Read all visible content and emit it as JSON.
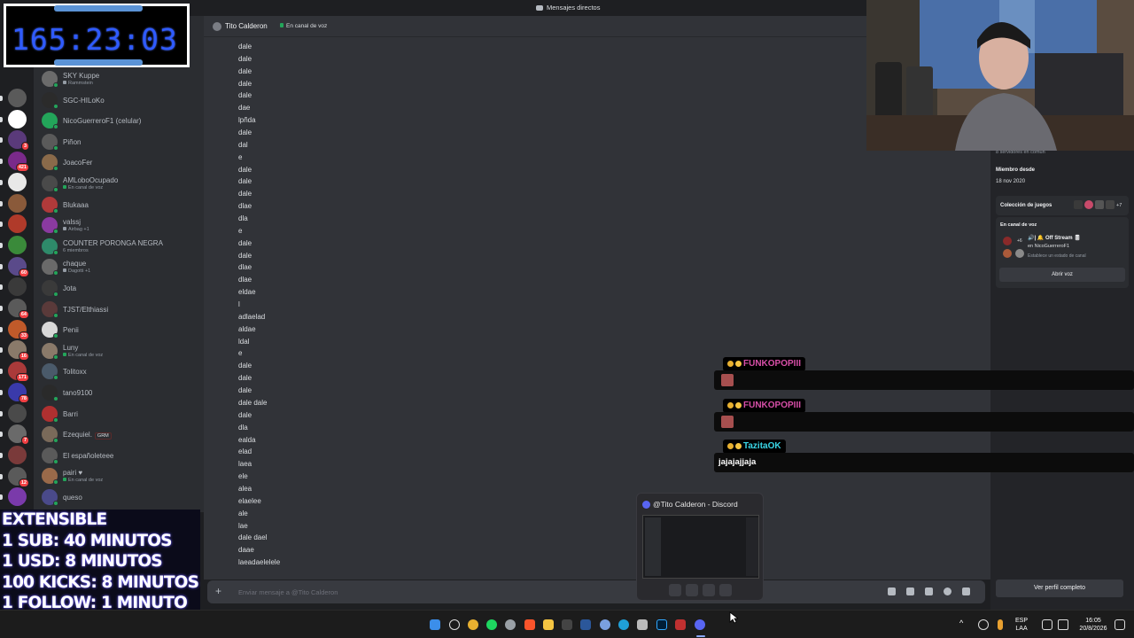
{
  "window": {
    "title": "Mensajes directos"
  },
  "timer": {
    "display": "165:23:03"
  },
  "dm_list": [
    {
      "name": "SKY Kuppe",
      "sub": "Rammstein",
      "icon": "music-icon",
      "color": "#6b6b6b"
    },
    {
      "name": "SGC-HILoKo",
      "sub": "",
      "color": "#2b2b2b"
    },
    {
      "name": "NicoGuerreroF1 (celular)",
      "sub": "",
      "color": "#23a55a"
    },
    {
      "name": "Piñon",
      "sub": "",
      "color": "#5a5a5a"
    },
    {
      "name": "JoacoFer",
      "sub": "",
      "color": "#8a6a4a"
    },
    {
      "name": "AMLoboOcupado",
      "sub": "En canal de voz",
      "icon": "voice-icon",
      "color": "#4a4a4a"
    },
    {
      "name": "Blukaaa",
      "sub": "",
      "color": "#b03a3a"
    },
    {
      "name": "valssj",
      "sub": "Airbag +1",
      "icon": "music-icon",
      "color": "#8a3aa0"
    },
    {
      "name": "COUNTER PORONGA NEGRA",
      "sub": "6 miembros",
      "color": "#2e8a6a"
    },
    {
      "name": "chaque",
      "sub": "Dagotti +1",
      "icon": "music-icon",
      "color": "#6a6a6a"
    },
    {
      "name": "Jota",
      "sub": "",
      "color": "#3a3a3a"
    },
    {
      "name": "TJST/Elthiassi",
      "sub": "",
      "color": "#5a3a3a"
    },
    {
      "name": "Penii",
      "sub": "",
      "color": "#d8d8d8"
    },
    {
      "name": "Luny",
      "sub": "En canal de voz",
      "icon": "voice-icon",
      "color": "#8a7a6a"
    },
    {
      "name": "Tolitoxx",
      "sub": "",
      "color": "#4a5a6a"
    },
    {
      "name": "tano9100",
      "sub": "",
      "color": "#2a2a2a"
    },
    {
      "name": "Barri",
      "sub": "",
      "color": "#b03030"
    },
    {
      "name": "Ezequiel.",
      "sub": "",
      "tag": "GRM",
      "color": "#7a6a5a"
    },
    {
      "name": "El españoleteee",
      "sub": "",
      "color": "#5a5a5a"
    },
    {
      "name": "pairi ♥",
      "sub": "En canal de voz",
      "icon": "voice-icon",
      "color": "#9a6a4a"
    },
    {
      "name": "queso",
      "sub": "",
      "color": "#4a4a8a"
    }
  ],
  "servers": [
    {
      "color": "#5a5a5a"
    },
    {
      "color": "#ffffff"
    },
    {
      "color": "#5a3a7a",
      "badge": "3"
    },
    {
      "color": "#7a2a8a",
      "badge": "421"
    },
    {
      "color": "#e8e8e8"
    },
    {
      "color": "#8a5a3a"
    },
    {
      "color": "#b03a2a"
    },
    {
      "color": "#3a8a3a"
    },
    {
      "color": "#5a4a8a",
      "badge": "60"
    },
    {
      "color": "#3a3a3a"
    },
    {
      "color": "#5a5a5a",
      "badge": "64"
    },
    {
      "color": "#c05a2a",
      "badge": "33"
    },
    {
      "color": "#8a7a6a",
      "badge": "16"
    },
    {
      "color": "#aa3a3a",
      "badge": "171"
    },
    {
      "color": "#3a3aaa",
      "badge": "78"
    },
    {
      "color": "#4a4a4a"
    },
    {
      "color": "#6a6a6a",
      "badge": "7"
    },
    {
      "color": "#7a3a3a"
    },
    {
      "color": "#5a5a5a",
      "badge": "12"
    },
    {
      "color": "#7a3aaa"
    }
  ],
  "chat": {
    "recipient": "Tito Calderon",
    "recipient_status": "En canal de voz",
    "messages": [
      "dale",
      "dale",
      "dale",
      "dale",
      "dale",
      "dae",
      "lpñda",
      "dale",
      "dal",
      "e",
      "dale",
      "dale",
      "dale",
      "dlae",
      "dla",
      "e",
      "dale",
      "dale",
      "dlae",
      "dlae",
      "eldae",
      "l",
      "adlaelad",
      "aldae",
      "ldal",
      "e",
      "dale",
      "dale",
      "dale",
      "dale dale",
      "dale",
      "dla",
      "ealda",
      "elad",
      "laea",
      "ele",
      "alea",
      "elaelee",
      "ale",
      "lae",
      "dale dael",
      "daae",
      "laeadaelelele"
    ],
    "composer_placeholder": "Enviar mensaje a @Tito Calderon"
  },
  "profile": {
    "common_servers": "8 servidores en común",
    "member_since_label": "Miembro desde",
    "member_since": "18 nov 2020",
    "games_label": "Colección de juegos",
    "games_extra": "+7",
    "voice_label": "En canal de voz",
    "voice_count": "+6",
    "voice_channel": "🔊| 🔔 Off Stream 🎚",
    "voice_server": "en NicoGuerreroF1",
    "voice_status": "Establece un estado de canal",
    "open_voice": "Abrir voz",
    "full_profile": "Ver perfil completo"
  },
  "overlay_chat": [
    {
      "user": "FUNKOPOPIII",
      "color": "#d84fa8",
      "emote": true,
      "text": ""
    },
    {
      "user": "FUNKOPOPIII",
      "color": "#d84fa8",
      "emote": true,
      "text": ""
    },
    {
      "user": "TazitaOK",
      "color": "#3ad8e8",
      "emote": false,
      "text": "jajajajjaja"
    }
  ],
  "extensible": {
    "lines": [
      "EXTENSIBLE",
      "1 SUB: 40 MINUTOS",
      "1 USD: 8 MINUTOS",
      "100 KICKS: 8 MINUTOS",
      "1 FOLLOW: 1 MINUTO"
    ]
  },
  "taskbar_preview": {
    "title": "@Tito Calderon - Discord"
  },
  "taskbar": {
    "lang": "ESP",
    "layout": "LAA",
    "time": "16:05",
    "date": "20/8/2026"
  },
  "colors": {
    "accent": "#5865f2",
    "online": "#23a55a",
    "danger": "#f23f43"
  }
}
